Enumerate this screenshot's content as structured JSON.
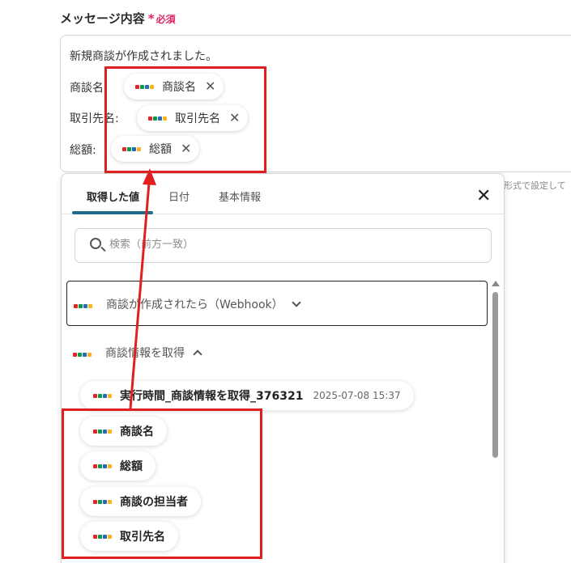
{
  "field": {
    "label": "メッセージ内容",
    "required_star": "*",
    "required_text": "必須"
  },
  "editor": {
    "line1": "新規商談が作成されました。",
    "rows": [
      {
        "prefix": "商談名:",
        "chip": "商談名"
      },
      {
        "prefix": "取引先名:",
        "chip": "取引先名"
      },
      {
        "prefix": "総額:",
        "chip": "総額"
      }
    ]
  },
  "hint_text": "形式で設定して",
  "panel": {
    "tabs": [
      "取得した値",
      "日付",
      "基本情報"
    ],
    "search_placeholder": "検索（前方一致）",
    "groups": [
      {
        "title": "商談が作成されたら（Webhook）",
        "state": "collapsed"
      },
      {
        "title": "商談情報を取得",
        "state": "expanded"
      }
    ],
    "items": [
      {
        "label": "実行時間_商談情報を取得_376321",
        "timestamp": "2025-07-08 15:37"
      },
      {
        "label": "商談名"
      },
      {
        "label": "総額"
      },
      {
        "label": "商談の担当者"
      },
      {
        "label": "取引先名"
      }
    ]
  },
  "icons": {
    "service_logo": "zoho-logo-icon",
    "logo_colors": [
      "#e42527",
      "#089949",
      "#226db4",
      "#f9b21d"
    ]
  },
  "colors": {
    "required": "#e0245e",
    "annotation": "#e02020",
    "tab_underline": "#1f6a8a"
  }
}
